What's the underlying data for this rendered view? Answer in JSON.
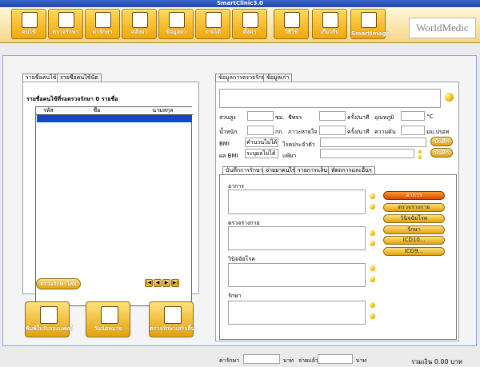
{
  "window": {
    "title": "SmartClinic3.0"
  },
  "toolbar": {
    "buttons": [
      {
        "label": "คนไข้"
      },
      {
        "label": "ตรวจรักษา"
      },
      {
        "label": "ค่ารักษา"
      },
      {
        "label": "คลังยา"
      },
      {
        "label": "ข้อมูลยา"
      },
      {
        "label": "รายได้"
      },
      {
        "label": "ตั้งค่า"
      },
      {
        "label": "วิธีใช้"
      },
      {
        "label": "เกี่ยวกับ"
      },
      {
        "label": "SmartImage"
      }
    ],
    "brand": "WorldMedic"
  },
  "left": {
    "tabs": [
      "รายชื่อคนไข้",
      "รายชื่อคนไข้นัด"
    ],
    "list_title": "รายชื่อคนไข้ที่รอตรวจรักษา 0 รายชื่อ",
    "columns": [
      "รหัส",
      "ชื่อ",
      "นามสกุล"
    ],
    "examine_button": "ตรวจรักษาใหม่",
    "nav": [
      "I◀",
      "◀",
      "▶",
      "▶I"
    ],
    "bottom_buttons": [
      "พิมพ์ใบรับรองแพทย์",
      "วันนัดหมาย",
      "ตรวจรักษาเสร็จสิ้น"
    ]
  },
  "right": {
    "top_tabs": [
      "ข้อมูลการตรวจรักษา",
      "ข้อมูลเก่า"
    ],
    "vitals": {
      "height_label": "ส่วนสูง",
      "height_unit": "ซม.",
      "weight_label": "น้ำหนัก",
      "weight_unit": "กก.",
      "pulse_label": "ชีพจร",
      "pulse_unit": "ครั้ง/นาที",
      "temp_label": "อุณหภูมิ",
      "temp_unit": "°C",
      "resp_label": "ภาวะหายใจ",
      "resp_unit": "ครั้ง/นาที",
      "bp_label": "ความดัน",
      "bp_unit": "มม.ปรอท",
      "bmi_label": "BMI",
      "bmi_value": "คำนวนไม่ได้",
      "bmi_result_label": "ผล BMI",
      "bmi_result_value": "ระบุผลไม่ได้",
      "disease_label": "โรคประจำตัว",
      "allergy_label": "แพ้ยา",
      "save_btn": "บันทึก"
    },
    "lower_tabs": [
      "บันทึกการรักษา",
      "จ่ายยาคนไข้",
      "รายการแล็บ",
      "หัตถการและอื่นๆ"
    ],
    "fields": [
      "อาการ",
      "ตรวจร่างกาย",
      "วินิจฉัยโรค",
      "รักษา"
    ],
    "side_buttons": [
      "อาการ",
      "ตรวจร่างกาย",
      "วินิจฉัยโรค",
      "รักษา",
      "ICD10...",
      "ICD9..."
    ],
    "fee_label": "ค่ารักษา",
    "fee_unit": "บาท",
    "paid_label": "จ่ายแล้ว",
    "paid_unit": "บาท",
    "total_text": "รวมเงิน 0.00 บาท"
  }
}
